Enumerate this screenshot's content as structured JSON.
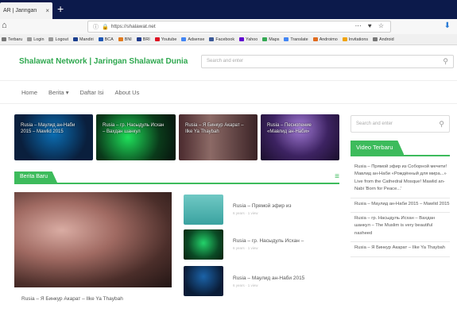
{
  "browser": {
    "tab_title": "AR | Jaringan",
    "tab_close": "×",
    "new_tab": "+",
    "url": "https://shalawat.net",
    "toolbar_icons": "⋯ ♥ ☆",
    "bookmarks": [
      "Terbaru",
      "Login",
      "Logout",
      "Mandiri",
      "BCA",
      "BNI",
      "BRI",
      "Youtube",
      "Adsense",
      "Facebook",
      "Yahoo",
      "Maps",
      "Translate",
      "Androimo",
      "Invitations",
      "Android"
    ]
  },
  "site": {
    "title": "Shalawat Network | Jaringan Shalawat Dunia",
    "search_placeholder": "Search and enter"
  },
  "menu": {
    "items": [
      "Home",
      "Berita ▾",
      "Daftar Isi",
      "About Us"
    ]
  },
  "slider": [
    {
      "caption": "Rusia – Маулид ан-Наби 2015 – Mawlid 2015"
    },
    {
      "caption": "Rusia – гр. Насыдуль Исхан – Вахдан шанкул"
    },
    {
      "caption": "Rusia – Я Бинкур Акарат – Ilke Ya Thaybah"
    },
    {
      "caption": "Rusia – Песнопение «Мавлид ан-Наби»"
    }
  ],
  "sidebar": {
    "search_placeholder": "Search and enter",
    "widget_title": "Video Terbaru",
    "videos": [
      "Rusia – Прямой эфир из Соборной мечети! Мавлид ан-Наби «Рождённый для мира...» Live from the Cathedral Mosque! Mawlid an-Nabi 'Born for Peace...'",
      "Rusia – Маулид ан-Наби 2015 – Mawlid 2015",
      "Rusia – гр. Насыдуль Исхан – Вахдан шанкул – The Muslim is very beautiful nasheed",
      "Rusia – Я Бинкур Акарат – Ilke Ya Thaybah"
    ]
  },
  "main": {
    "section_title": "Berita Baru",
    "feature_caption": "Rusia – Я Бинкур Акарат – Ilke Ya Thaybah",
    "items": [
      {
        "title": "Rusia – Прямой эфир из",
        "meta": "6 years · 1 view"
      },
      {
        "title": "Rusia – гр. Насыдуль Исхан –",
        "meta": "6 years · 1 view"
      },
      {
        "title": "Rusia – Маулид ан-Наби 2015",
        "meta": "6 years · 1 view"
      }
    ]
  },
  "colors": {
    "accent": "#3dbb5c",
    "tabbar": "#0c1a4b",
    "title": "#2fa84f"
  }
}
